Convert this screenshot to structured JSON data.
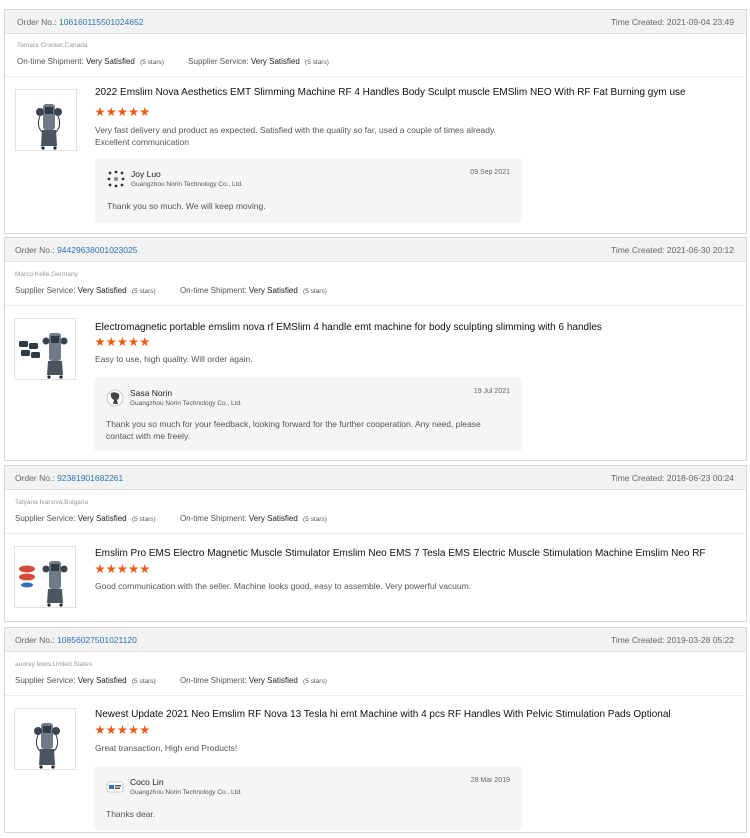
{
  "labels": {
    "order_no": "Order No.:",
    "time_created": "Time Created:",
    "ontime": "On-time Shipment:",
    "supplier": "Supplier Service:"
  },
  "reviews": [
    {
      "order_no": "106160115501024652",
      "time_created": "2021-09-04 23:49",
      "buyer": "Tamara Crocker,Canada",
      "rating1": {
        "value": "Very Satisfied",
        "stars": "(5 stars)"
      },
      "rating2": {
        "value": "Very Satisfied",
        "stars": "(5 stars)"
      },
      "product_title": "2022 Emslim Nova Aesthetics EMT Slimming Machine RF 4 Handles Body Sculpt muscle EMSlim NEO With RF Fat Burning gym use",
      "star_rating": 5,
      "comment_line1": "Very fast delivery and product as expected. Satisfied with the quality so far, used a couple of times already.",
      "comment_line2": "Excellent communication",
      "reply": {
        "name": "Joy Luo",
        "company": "Guangzhou Norin Technology Co., Ltd.",
        "date": "09 Sep 2021",
        "text_line1": "Thank you so much. We will keep moving.",
        "text_line2": ""
      }
    },
    {
      "order_no": "94429638001023025",
      "time_created": "2021-06-30 20:12",
      "buyer": "Marco Kelle,Germany",
      "rating1": {
        "value": "Very Satisfied",
        "stars": "(5 stars)"
      },
      "rating2": {
        "value": "Very Satisfied",
        "stars": "(5 stars)"
      },
      "product_title": "Electromagnetic portable emslim nova rf EMSlim 4 handle emt machine for body sculpting slimming with 6 handles",
      "star_rating": 5,
      "comment_line1": "Easy to use, high quality. Will order again.",
      "comment_line2": "",
      "reply": {
        "name": "Sasa Norin",
        "company": "Guangzhou Norin Technology Co., Ltd.",
        "date": "19 Jul 2021",
        "text_line1": "Thank you so much for your feedback, looking forward for the further cooperation. Any need, please",
        "text_line2": "contact with me freely."
      }
    },
    {
      "order_no": "92381901682261",
      "time_created": "2018-06-23 00:24",
      "buyer": "Tatyana Ivanova,Bulgaria",
      "rating1": {
        "value": "Very Satisfied",
        "stars": "(5 stars)"
      },
      "rating2": {
        "value": "Very Satisfied",
        "stars": "(5 stars)"
      },
      "product_title": "Emslim Pro EMS Electro Magnetic Muscle Stimulator Emslim Neo EMS 7 Tesla EMS Electric Muscle Stimulation Machine Emslim Neo RF",
      "star_rating": 5,
      "comment_line1": "Good communication with the seller. Machine looks good, easy to assemble. Very powerful vacuum.",
      "comment_line2": ""
    },
    {
      "order_no": "10856027501021120",
      "time_created": "2019-03-28 05:22",
      "buyer": "audrey lewis,United States",
      "rating1": {
        "value": "Very Satisfied",
        "stars": "(5 stars)"
      },
      "rating2": {
        "value": "Very Satisfied",
        "stars": "(5 stars)"
      },
      "product_title": "Newest Update 2021 Neo Emslim RF Nova 13 Tesla hi emt Machine with 4 pcs RF Handles With Pelvic Stimulation Pads Optional",
      "star_rating": 5,
      "comment_line1": "Great transaction, High end Products!",
      "comment_line2": "",
      "reply": {
        "name": "Coco Lin",
        "company": "Guangzhou Norin Technology Co., Ltd.",
        "date": "28 Mar 2019",
        "text_line1": "Thanks dear.",
        "text_line2": ""
      }
    }
  ],
  "colors": {
    "order_link": "#2b73b6",
    "star": "#ee5a13",
    "header_bg": "#f2f2f2",
    "reply_bg": "#f5f5f5"
  }
}
